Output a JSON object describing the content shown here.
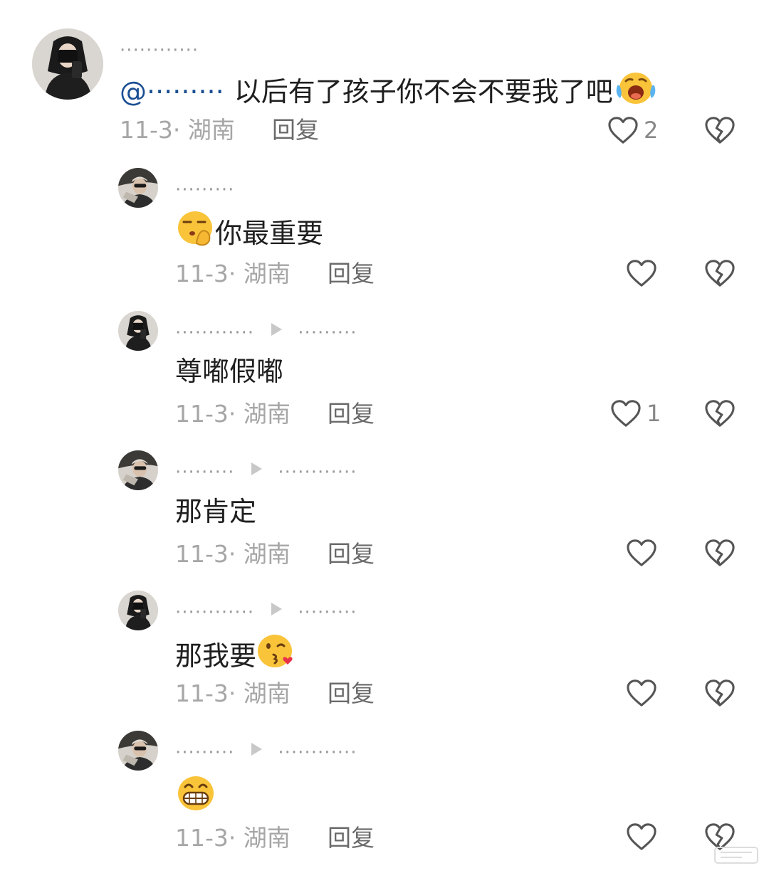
{
  "comments": [
    {
      "username": "············",
      "mention": "@·········",
      "text": "以后有了孩子你不会不要我了吧",
      "emoji": "sweat-cry-emoji",
      "meta": "11-3· 湖南",
      "reply_label": "回复",
      "likes": "2"
    },
    {
      "username": "·········",
      "emoji": "shush-emoji",
      "text": "你最重要",
      "meta": "11-3· 湖南",
      "reply_label": "回复",
      "likes": ""
    },
    {
      "username": "············",
      "reply_to": "·········",
      "text": "尊嘟假嘟",
      "meta": "11-3· 湖南",
      "reply_label": "回复",
      "likes": "1"
    },
    {
      "username": "·········",
      "reply_to": "············",
      "text": "那肯定",
      "meta": "11-3· 湖南",
      "reply_label": "回复",
      "likes": ""
    },
    {
      "username": "············",
      "reply_to": "·········",
      "text": "那我要",
      "emoji": "kiss-emoji",
      "meta": "11-3· 湖南",
      "reply_label": "回复",
      "likes": ""
    },
    {
      "username": "·········",
      "reply_to": "············",
      "emoji": "grin-emoji",
      "meta": "11-3· 湖南",
      "reply_label": "回复",
      "likes": ""
    }
  ],
  "colors": {
    "mention": "#1b4f93",
    "meta": "#a6a6a6",
    "icon": "#555555"
  }
}
